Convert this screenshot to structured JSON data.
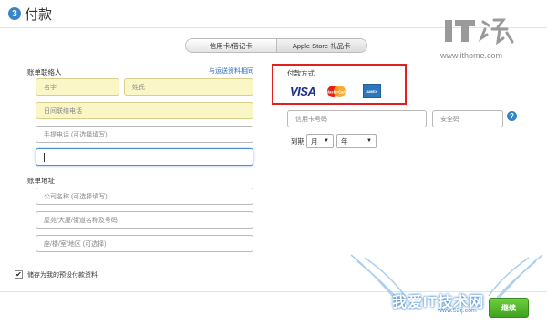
{
  "header": {
    "step_number": "3",
    "title": "付款"
  },
  "watermark": {
    "logo_text": "IT之家",
    "url": "www.ithome.com",
    "bottom_text": "我爱IT技术网",
    "bottom_url": "www.52ij.com"
  },
  "tabs": [
    {
      "label": "信用卡/借记卡",
      "active": true
    },
    {
      "label": "Apple Store 礼品卡",
      "active": false
    }
  ],
  "billing_contact": {
    "section_label": "账单联络人",
    "copy_link": "与运送资料相同",
    "first_name_placeholder": "名字",
    "last_name_placeholder": "姓氏",
    "day_phone_placeholder": "日间联络电话",
    "mobile_phone_placeholder": "手提电话 (可选择填写)",
    "email_value": ""
  },
  "billing_address": {
    "section_label": "账单地址",
    "company_placeholder": "公司名称 (可选择填写)",
    "street_placeholder": "屋苑/大厦/街道名称及号码",
    "unit_placeholder": "座/楼/室/地区 (可选择)"
  },
  "payment": {
    "label": "付款方式",
    "cards": [
      "VISA",
      "MasterCard",
      "AMEX"
    ],
    "card_number_placeholder": "信用卡号码",
    "security_code_placeholder": "安全码",
    "help_icon": "?",
    "expiry_label": "到期",
    "month_value": "月",
    "year_value": "年"
  },
  "save_default": {
    "checked": true,
    "label": "储存为我的预设付款资料"
  },
  "continue_button": "继续",
  "colors": {
    "accent_blue": "#3a84c8",
    "highlight_red": "#e02020",
    "continue_green": "#4cb326",
    "required_yellow": "#fbf6c6"
  }
}
